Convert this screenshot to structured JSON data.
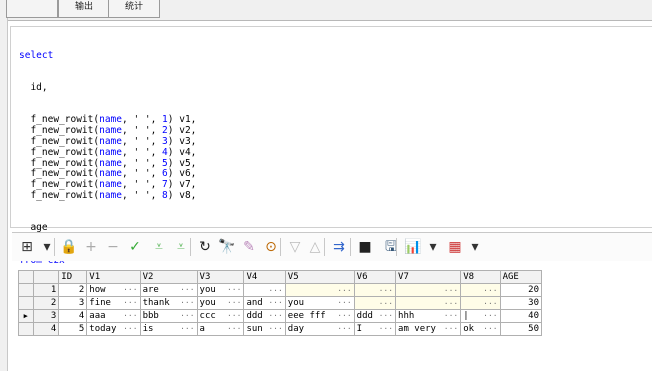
{
  "tabs": [
    "",
    "输出",
    "统计"
  ],
  "sql": {
    "line1": "select",
    "line2": "  id,",
    "rows": [
      {
        "fn": "f_new_rowit",
        "name": "name",
        "sep": "' '",
        "n": "1",
        "alias": "v1,"
      },
      {
        "fn": "f_new_rowit",
        "name": "name",
        "sep": "' '",
        "n": "2",
        "alias": "v2,"
      },
      {
        "fn": "f_new_rowit",
        "name": "name",
        "sep": "' '",
        "n": "3",
        "alias": "v3,"
      },
      {
        "fn": "f_new_rowit",
        "name": "name",
        "sep": "' '",
        "n": "4",
        "alias": "v4,"
      },
      {
        "fn": "f_new_rowit",
        "name": "name",
        "sep": "' '",
        "n": "5",
        "alias": "v5,"
      },
      {
        "fn": "f_new_rowit",
        "name": "name",
        "sep": "' '",
        "n": "6",
        "alias": "v6,"
      },
      {
        "fn": "f_new_rowit",
        "name": "name",
        "sep": "' '",
        "n": "7",
        "alias": "v7,"
      },
      {
        "fn": "f_new_rowit",
        "name": "name",
        "sep": "' '",
        "n": "8",
        "alias": "v8,"
      }
    ],
    "line_age": "  age",
    "line_from": "from czx"
  },
  "toolbar": {
    "icons": [
      "grid-icon",
      "dropdown-arrow-icon",
      "lock-icon",
      "add-icon",
      "remove-icon",
      "post-icon",
      "filter-down-icon",
      "filter-down2-icon",
      "refresh-icon",
      "find-icon",
      "clear-icon",
      "query-by-example-icon",
      "filter-icon",
      "filter-up-icon",
      "link-icon",
      "save-icon",
      "print-icon",
      "chart-icon",
      "chart-dropdown-icon",
      "export-icon",
      "export-dropdown-icon"
    ],
    "glyphs": [
      "⊞",
      "▾",
      "🔒",
      "+",
      "−",
      "✓",
      "⩡",
      "⩡",
      "↻",
      "🔭",
      "✎",
      "⊙",
      "▽",
      "△",
      "⇉",
      "■",
      "🖫",
      "📊",
      "▾",
      "▦",
      "▾"
    ]
  },
  "grid": {
    "columns": [
      "ID",
      "V1",
      "V2",
      "V3",
      "V4",
      "V5",
      "V6",
      "V7",
      "V8",
      "AGE"
    ],
    "rows": [
      {
        "rn": "1",
        "cells": [
          "2",
          "how",
          "are",
          "you",
          "",
          "",
          "",
          "",
          "",
          "20"
        ],
        "current": false
      },
      {
        "rn": "2",
        "cells": [
          "3",
          "fine",
          "thank",
          "you",
          "and",
          "you",
          "",
          "",
          "",
          "30"
        ],
        "current": false
      },
      {
        "rn": "3",
        "cells": [
          "4",
          "aaa",
          "bbb",
          "ccc",
          "ddd",
          "eee fff",
          "ddd",
          "hhh",
          "|",
          "40"
        ],
        "current": true
      },
      {
        "rn": "4",
        "cells": [
          "5",
          "today",
          "is",
          "a",
          "sun",
          "day",
          "I",
          "am very",
          "ok",
          "50"
        ],
        "current": false
      }
    ],
    "ellipsis": "···",
    "current_marker": "▶"
  }
}
